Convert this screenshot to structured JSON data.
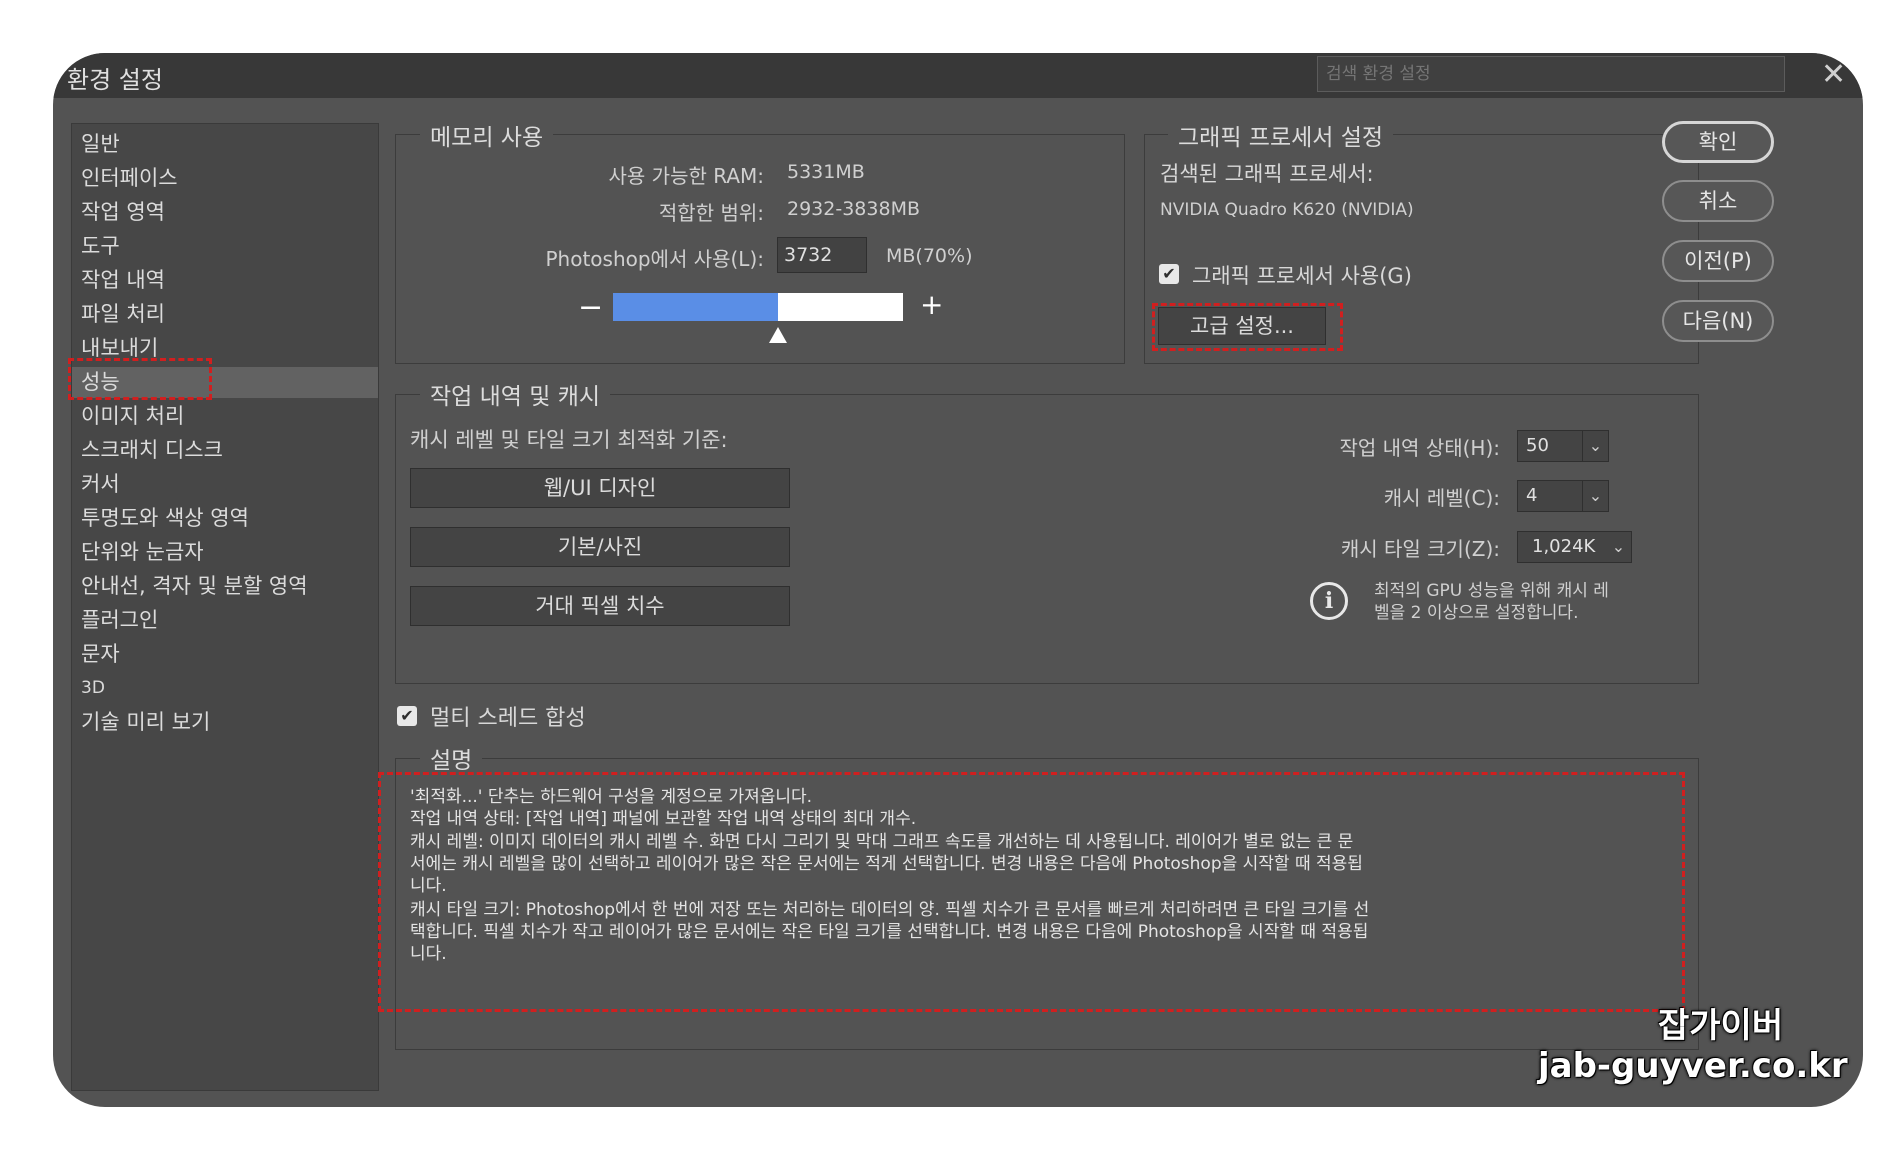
{
  "window": {
    "title": "환경 설정",
    "search_placeholder": "검색 환경 설정",
    "close_glyph": "✕"
  },
  "sidebar": {
    "items": [
      "일반",
      "인터페이스",
      "작업 영역",
      "도구",
      "작업 내역",
      "파일 처리",
      "내보내기",
      "성능",
      "이미지 처리",
      "스크래치 디스크",
      "커서",
      "투명도와 색상 영역",
      "단위와 눈금자",
      "안내선, 격자 및 분할 영역",
      "플러그인",
      "문자",
      "3D",
      "기술 미리 보기"
    ],
    "active_index": 7
  },
  "memory": {
    "legend": "메모리 사용",
    "ram_label": "사용 가능한 RAM:",
    "ram_value": "5331MB",
    "range_label": "적합한 범위:",
    "range_value": "2932-3838MB",
    "use_label": "Photoshop에서 사용(L):",
    "use_value": "3732",
    "use_suffix": "MB(70%)",
    "slider_fraction": 0.7,
    "minus": "−",
    "plus": "+"
  },
  "gpu": {
    "legend": "그래픽 프로세서 설정",
    "detected_label": "검색된 그래픽 프로세서:",
    "detected_value": "NVIDIA Quadro K620 (NVIDIA)",
    "use_gpu_label": "그래픽 프로세서 사용(G)",
    "use_gpu_checked": true,
    "advanced_button": "고급 설정..."
  },
  "history": {
    "legend": "작업 내역 및 캐시",
    "optimize_label": "캐시 레벨 및 타일 크기 최적화 기준:",
    "buttons": [
      "웹/UI 디자인",
      "기본/사진",
      "거대 픽셀 치수"
    ],
    "states_label": "작업 내역 상태(H):",
    "states_value": "50",
    "cache_levels_label": "캐시 레벨(C):",
    "cache_levels_value": "4",
    "tile_label": "캐시 타일 크기(Z):",
    "tile_value": "1,024K",
    "info_line1": "최적의 GPU 성능을 위해 캐시 레",
    "info_line2": "벨을 2 이상으로 설정합니다."
  },
  "multithread": {
    "label": "멀티 스레드 합성",
    "checked": true
  },
  "description": {
    "legend": "설명",
    "lines": [
      "'최적화...' 단추는 하드웨어 구성을 계정으로 가져옵니다.",
      "작업 내역 상태: [작업 내역] 패널에 보관할 작업 내역 상태의 최대 개수.",
      "캐시 레벨: 이미지 데이터의 캐시 레벨 수. 화면 다시 그리기 및 막대 그래프 속도를 개선하는 데 사용됩니다. 레이어가 별로 없는 큰 문",
      "서에는 캐시 레벨을 많이 선택하고 레이어가 많은 작은 문서에는 적게 선택합니다. 변경 내용은 다음에 Photoshop을 시작할 때 적용됩",
      "니다.",
      "캐시 타일 크기: Photoshop에서 한 번에 저장 또는 처리하는 데이터의 양. 픽셀 치수가 큰 문서를 빠르게 처리하려면 큰 타일 크기를 선",
      "택합니다. 픽셀 치수가 작고 레이어가 많은 문서에는 작은 타일 크기를 선택합니다. 변경 내용은 다음에 Photoshop을 시작할 때 적용됩",
      "니다."
    ]
  },
  "actions": {
    "ok": "확인",
    "cancel": "취소",
    "prev": "이전(P)",
    "next": "다음(N)"
  },
  "watermark": {
    "line1": "잡가이버",
    "line2": "jab-guyver.co.kr"
  }
}
